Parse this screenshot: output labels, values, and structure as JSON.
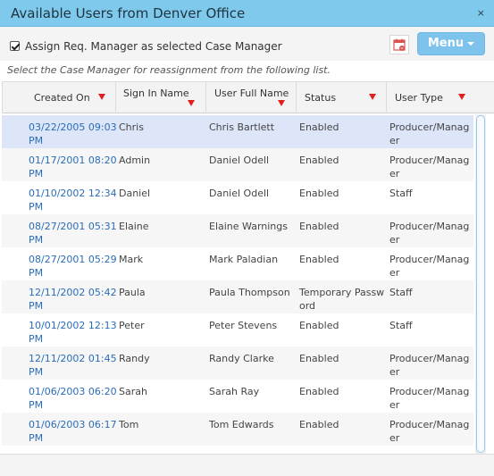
{
  "window": {
    "title": "Available Users from Denver Office",
    "close_glyph": "×"
  },
  "toolbar": {
    "assign_checkbox_checked": true,
    "assign_label": "Assign Req. Manager as selected Case Manager",
    "export_icon": "calendar-export-icon",
    "menu_label": "Menu"
  },
  "instruction": "Select the Case Manager for reassignment from the following list.",
  "grid": {
    "columns": [
      {
        "label": "Created On"
      },
      {
        "label": "Sign In Name"
      },
      {
        "label": "User Full Name"
      },
      {
        "label": "Status"
      },
      {
        "label": "User Type"
      }
    ],
    "rows": [
      {
        "date1": "03/22/2005 09:03",
        "date2": "PM",
        "signin": "Chris",
        "fullname": "Chris Bartlett",
        "status1": "Enabled",
        "status2": "",
        "type1": "Producer/Manag",
        "type2": "er"
      },
      {
        "date1": "01/17/2001 08:20",
        "date2": "PM",
        "signin": "Admin",
        "fullname": "Daniel Odell",
        "status1": "Enabled",
        "status2": "",
        "type1": "Producer/Manag",
        "type2": "er"
      },
      {
        "date1": "01/10/2002 12:34",
        "date2": "PM",
        "signin": "Daniel",
        "fullname": "Daniel Odell",
        "status1": "Enabled",
        "status2": "",
        "type1": "Staff",
        "type2": ""
      },
      {
        "date1": "08/27/2001 05:31",
        "date2": "PM",
        "signin": "Elaine",
        "fullname": "Elaine Warnings",
        "status1": "Enabled",
        "status2": "",
        "type1": "Producer/Manag",
        "type2": "er"
      },
      {
        "date1": "08/27/2001 05:29",
        "date2": "PM",
        "signin": "Mark",
        "fullname": "Mark Paladian",
        "status1": "Enabled",
        "status2": "",
        "type1": "Producer/Manag",
        "type2": "er"
      },
      {
        "date1": "12/11/2002 05:42",
        "date2": "PM",
        "signin": "Paula",
        "fullname": "Paula Thompson",
        "status1": "Temporary Passw",
        "status2": "ord",
        "type1": "Staff",
        "type2": ""
      },
      {
        "date1": "10/01/2002 12:13",
        "date2": "PM",
        "signin": "Peter",
        "fullname": "Peter Stevens",
        "status1": "Enabled",
        "status2": "",
        "type1": "Staff",
        "type2": ""
      },
      {
        "date1": "12/11/2002 01:45",
        "date2": "PM",
        "signin": "Randy",
        "fullname": "Randy Clarke",
        "status1": "Enabled",
        "status2": "",
        "type1": "Producer/Manag",
        "type2": "er"
      },
      {
        "date1": "01/06/2003 06:20",
        "date2": "PM",
        "signin": "Sarah",
        "fullname": "Sarah Ray",
        "status1": "Enabled",
        "status2": "",
        "type1": "Producer/Manag",
        "type2": "er"
      },
      {
        "date1": "01/06/2003 06:17",
        "date2": "PM",
        "signin": "Tom",
        "fullname": "Tom Edwards",
        "status1": "Enabled",
        "status2": "",
        "type1": "Producer/Manag",
        "type2": "er"
      }
    ]
  }
}
